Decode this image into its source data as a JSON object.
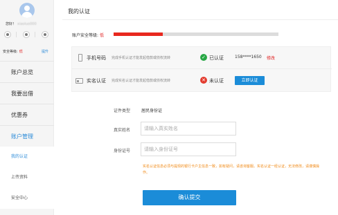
{
  "sidebar": {
    "greeting_label": "您好！",
    "username": "xiaoluo000",
    "security_label": "安全等级:",
    "security_value": "低",
    "upgrade_label": "提升",
    "menu": [
      {
        "label": "账户总览"
      },
      {
        "label": "我要出借"
      },
      {
        "label": "优惠券"
      },
      {
        "label": "账户管理"
      }
    ],
    "submenu": [
      {
        "label": "我的认证"
      },
      {
        "label": "上传资料"
      },
      {
        "label": "安全中心"
      }
    ]
  },
  "main": {
    "title": "我的认证",
    "security": {
      "label": "账户安全等级:",
      "level": "低",
      "progress_fraction": 0.3
    },
    "verifications": [
      {
        "name": "手机号码",
        "description": "完成手机认证才能发起借款或债权流转",
        "status": "已认证",
        "status_icon": "check-icon",
        "phone": "158****1650",
        "action": "修改"
      },
      {
        "name": "实名认证",
        "description": "完成实名认证才能发起借款或债权流转",
        "status": "未认证",
        "status_icon": "cross-icon",
        "action": "立即认证"
      }
    ],
    "form": {
      "id_type_label": "证件类型",
      "id_type_value": "居民身份证",
      "name_label": "真实姓名",
      "name_placeholder": "请输入真实姓名",
      "id_label": "身份证号",
      "id_placeholder": "请输入身份证号",
      "note": "实名认证信息必须与提现的银行卡户主信息一致，如有疑问，请咨询客服。实名认证一经认证，无法修改，请谨慎操作。",
      "submit_label": "确认提交"
    }
  },
  "colors": {
    "accent": "#1b8cd8",
    "danger": "#e8281e",
    "success": "#28a745",
    "warning_text": "#f08a17"
  }
}
